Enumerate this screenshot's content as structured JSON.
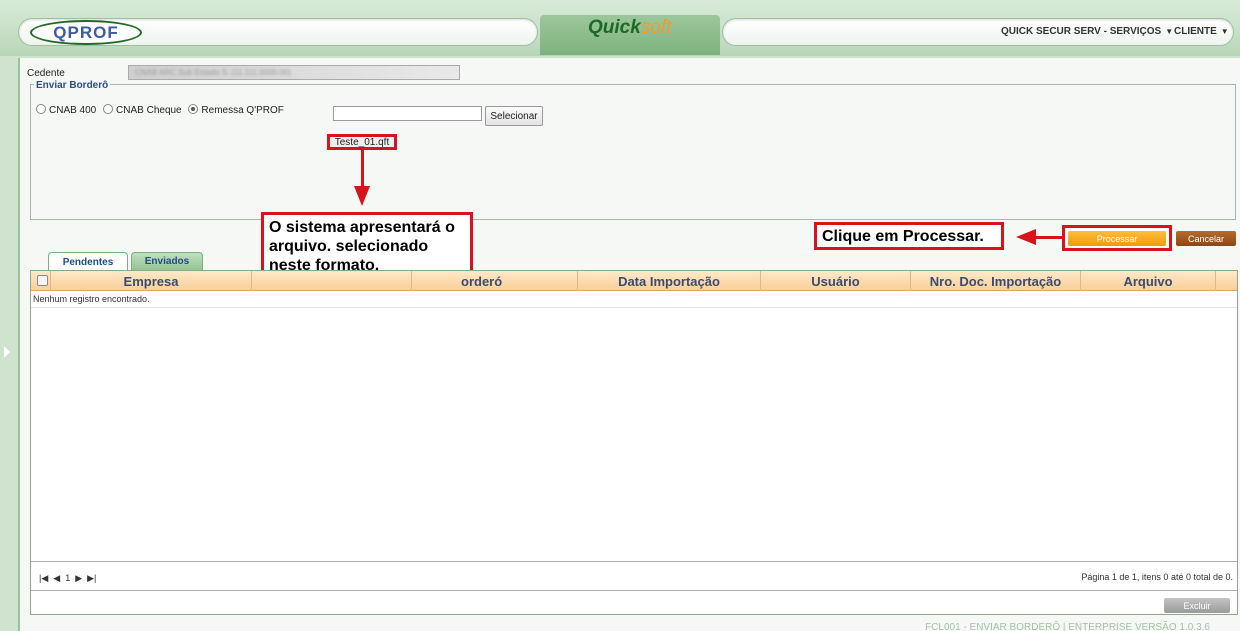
{
  "header": {
    "logo": "QPROF",
    "brand_quick": "Quick",
    "brand_soft": "soft",
    "menu_company": "QUICK SECUR SERV - SERVIÇOS",
    "menu_client": "CLIENTE"
  },
  "form": {
    "cedente_label": "Cedente",
    "cedente_value": "CNAB  ARC Sub Estado S. (11.111.0000-00)",
    "section_legend": "Enviar Borderô",
    "radio_options": [
      "CNAB 400",
      "CNAB Cheque",
      "Remessa Q'PROF"
    ],
    "selected_radio": "Remessa Q'PROF",
    "select_button": "Selecionar",
    "file_name": "Teste_01.qft"
  },
  "callouts": {
    "file_callout": "O sistema apresentará o arquivo. selecionado neste formato.",
    "process_callout": "Clique em Processar."
  },
  "actions": {
    "process": "Processar",
    "cancel": "Cancelar",
    "delete": "Excluir"
  },
  "tabs": [
    "Pendentes",
    "Enviados"
  ],
  "grid": {
    "columns": [
      "Empresa",
      "",
      "orderó",
      "Data Importação",
      "Usuário",
      "Nro. Doc. Importação",
      "Arquivo"
    ],
    "empty_message": "Nenhum registro encontrado."
  },
  "pager": {
    "current_page": "1",
    "info": "Página 1 de 1, itens 0 até 0 total de 0."
  },
  "footer": "FCL001 - ENVIAR BORDERÔ | ENTERPRISE VERSÃO 1.0.3.6"
}
